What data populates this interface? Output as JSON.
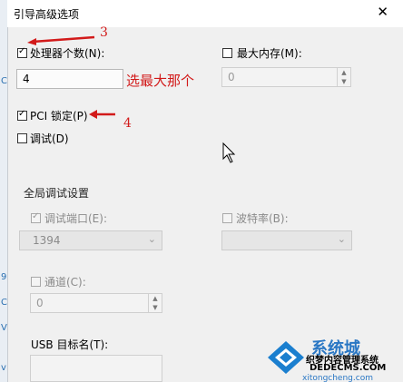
{
  "window": {
    "title": "引导高级选项",
    "close_glyph": "✕"
  },
  "processors": {
    "label": "处理器个数(N):",
    "checked": true,
    "value": "4"
  },
  "max_memory": {
    "label": "最大内存(M):",
    "checked": false,
    "value": "0"
  },
  "pci_lock": {
    "label": "PCI 锁定(P)",
    "checked": true
  },
  "debug": {
    "label": "调试(D)",
    "checked": false
  },
  "global_debug": {
    "title": "全局调试设置",
    "debug_port": {
      "label": "调试端口(E):",
      "checked": true,
      "value": "1394"
    },
    "baud_rate": {
      "label": "波特率(B):",
      "checked": false
    },
    "channel": {
      "label": "通道(C):",
      "checked": false,
      "value": "0"
    },
    "usb_target": {
      "label": "USB 目标名(T):"
    }
  },
  "annotations": {
    "n3": "3",
    "n4": "4",
    "pick_max": "选最大那个",
    "color": "#d21a1a"
  },
  "watermark": {
    "brand": "系统城",
    "line1": "织梦内容管理系统",
    "line2": "DEDECMS.COM",
    "line3": "xitongcheng.com"
  },
  "left_edge_chars": [
    "C",
    "9",
    "C",
    "V",
    "v"
  ]
}
